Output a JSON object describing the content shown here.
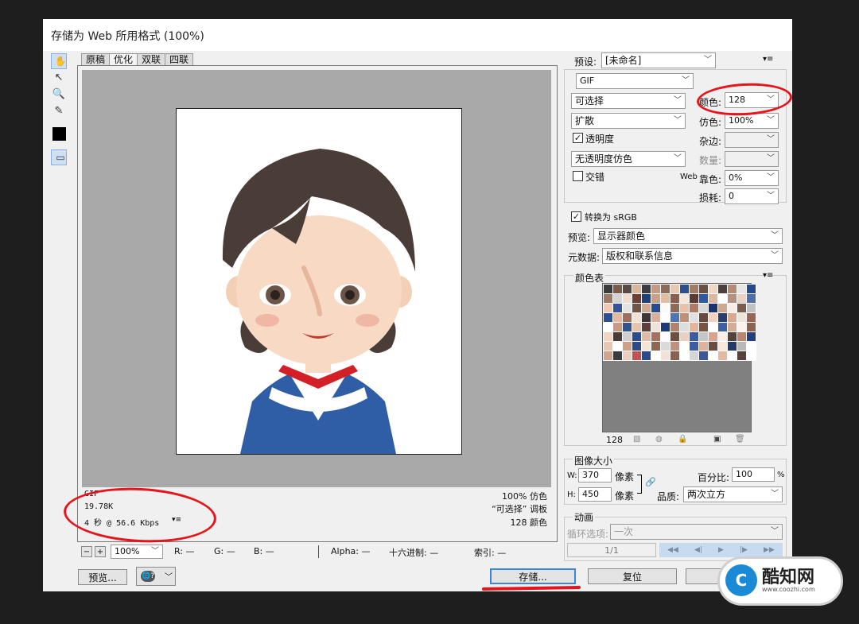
{
  "dialog": {
    "title": "存储为 Web 所用格式 (100%)"
  },
  "tabs": [
    "原稿",
    "优化",
    "双联",
    "四联"
  ],
  "active_tab": 1,
  "image_info": {
    "format": "GIF",
    "size": "19.78K",
    "time": "4 秒 @ 56.6 Kbps",
    "dither": "100% 仿色",
    "palette": "“可选择” 调板",
    "colors": "128 颜色"
  },
  "bottom_bar": {
    "zoom": "100%",
    "r": "R: —",
    "g": "G: —",
    "b": "B: —",
    "alpha": "Alpha: —",
    "hex": "十六进制: —",
    "index": "索引: —"
  },
  "buttons": {
    "preview": "预览...",
    "save": "存储...",
    "reset": "复位"
  },
  "settings": {
    "preset_label": "预设:",
    "preset_value": "[未命名]",
    "format_value": "GIF",
    "reduction_value": "可选择",
    "colors_label": "颜色:",
    "colors_value": "128",
    "dither_algo_value": "扩散",
    "dither_label": "仿色:",
    "dither_value": "100%",
    "transparency_label": "透明度",
    "transparency_checked": true,
    "matte_label": "杂边:",
    "transparency_dither_value": "无透明度仿色",
    "amount_label": "数量:",
    "interlace_label": "交错",
    "interlace_checked": false,
    "web_snap_prefix": "Web",
    "web_snap_label": "靠色:",
    "web_snap_value": "0%",
    "lossy_label": "损耗:",
    "lossy_value": "0",
    "convert_srgb_label": "转换为 sRGB",
    "convert_srgb_checked": true,
    "preview_label": "预览:",
    "preview_value": "显示器颜色",
    "metadata_label": "元数据:",
    "metadata_value": "版权和联系信息"
  },
  "color_table": {
    "title": "颜色表",
    "count": "128",
    "swatches": [
      "#3b3a3d",
      "#7d5a4a",
      "#5b4a44",
      "#d9b59b",
      "#3d3a44",
      "#c49a84",
      "#8c6b5b",
      "#e8c9b0",
      "#2f4f8a",
      "#a77c66",
      "#6b4f42",
      "#f0d7c4",
      "#4a4040",
      "#b88a74",
      "#e6e6e6",
      "#23488c",
      "#a07866",
      "#d4d4d4",
      "#f2dccb",
      "#6d3f36",
      "#1f3f7a",
      "#c9a18b",
      "#e2bca3",
      "#8a5f4f",
      "#f5e6da",
      "#5a3c34",
      "#2e5aa4",
      "#dcb79f",
      "#ffffff",
      "#b39080",
      "#e8d2c2",
      "#4f6fa8",
      "#f0c8b4",
      "#35539a",
      "#e3e3e3",
      "#6f5548",
      "#d1a991",
      "#284a8f",
      "#fafafa",
      "#8e6a58",
      "#e9c1ab",
      "#b07a65",
      "#d8d8d8",
      "#1b3470",
      "#cfa892",
      "#f7ede4",
      "#7b5c4d",
      "#c2c2c2",
      "#2b4e94",
      "#e6b89f",
      "#9c6f5b",
      "#f3e1d3",
      "#3f3536",
      "#d6b09a",
      "#ffffff",
      "#4d74b3",
      "#bf8f78",
      "#e0e0e0",
      "#6a4a3f",
      "#f6d2be",
      "#2a3f6e",
      "#d9a88f",
      "#ede4dc",
      "#996656",
      "#ffffff",
      "#c99a82",
      "#34528f",
      "#e7c3ad",
      "#5c4039",
      "#f1e2d8",
      "#1e3b78",
      "#b4836d",
      "#dddddd",
      "#e5b49a",
      "#7a5243",
      "#ffffff",
      "#3d60a3",
      "#d3ae97",
      "#fdf3ec",
      "#8d6350",
      "#f2d4c2",
      "#4b3b37",
      "#cfcfcf",
      "#2c4c90",
      "#e1bba4",
      "#a6725f",
      "#ffffff",
      "#6e4d41",
      "#ecd0bf",
      "#3a5ca0",
      "#c6c6c6",
      "#d7a58c",
      "#fbeee4",
      "#55413b",
      "#b98770",
      "#243f7d",
      "#e8c6b2",
      "#ffffff",
      "#cf9f87",
      "#304a84",
      "#f4e3d7",
      "#8f6554",
      "#dadada",
      "#c0907a",
      "#ffffff",
      "#3c5da4",
      "#e0b29a",
      "#6b4c40",
      "#f7e8dd",
      "#263a6a",
      "#b9b9b9",
      "#ffffff",
      "#d2a48d",
      "#3b3a3d",
      "#e9cfbf",
      "#c4504f",
      "#2a4a8c",
      "#ffffff",
      "#f2e2d6",
      "#8a6251",
      "#ffffff",
      "#d6d6d6",
      "#3a5898",
      "#ffffff",
      "#e4baa3",
      "#ffffff",
      "#5a403a",
      "#ffffff"
    ]
  },
  "image_size": {
    "title": "图像大小",
    "w_label": "W:",
    "w_value": "370",
    "h_label": "H:",
    "h_value": "450",
    "unit": "像素",
    "percent_label": "百分比:",
    "percent_value": "100",
    "percent_unit": "%",
    "quality_label": "品质:",
    "quality_value": "两次立方"
  },
  "animation": {
    "title": "动画",
    "loop_label": "循环选项:",
    "loop_value": "一次",
    "frame": "1/1"
  },
  "watermark": {
    "brand": "酷知网",
    "url": "www.coozhi.com"
  },
  "colors": {
    "accent_red": "#e8141b",
    "hair": "#4a3d38",
    "uniform_blue": "#2f5da6"
  }
}
